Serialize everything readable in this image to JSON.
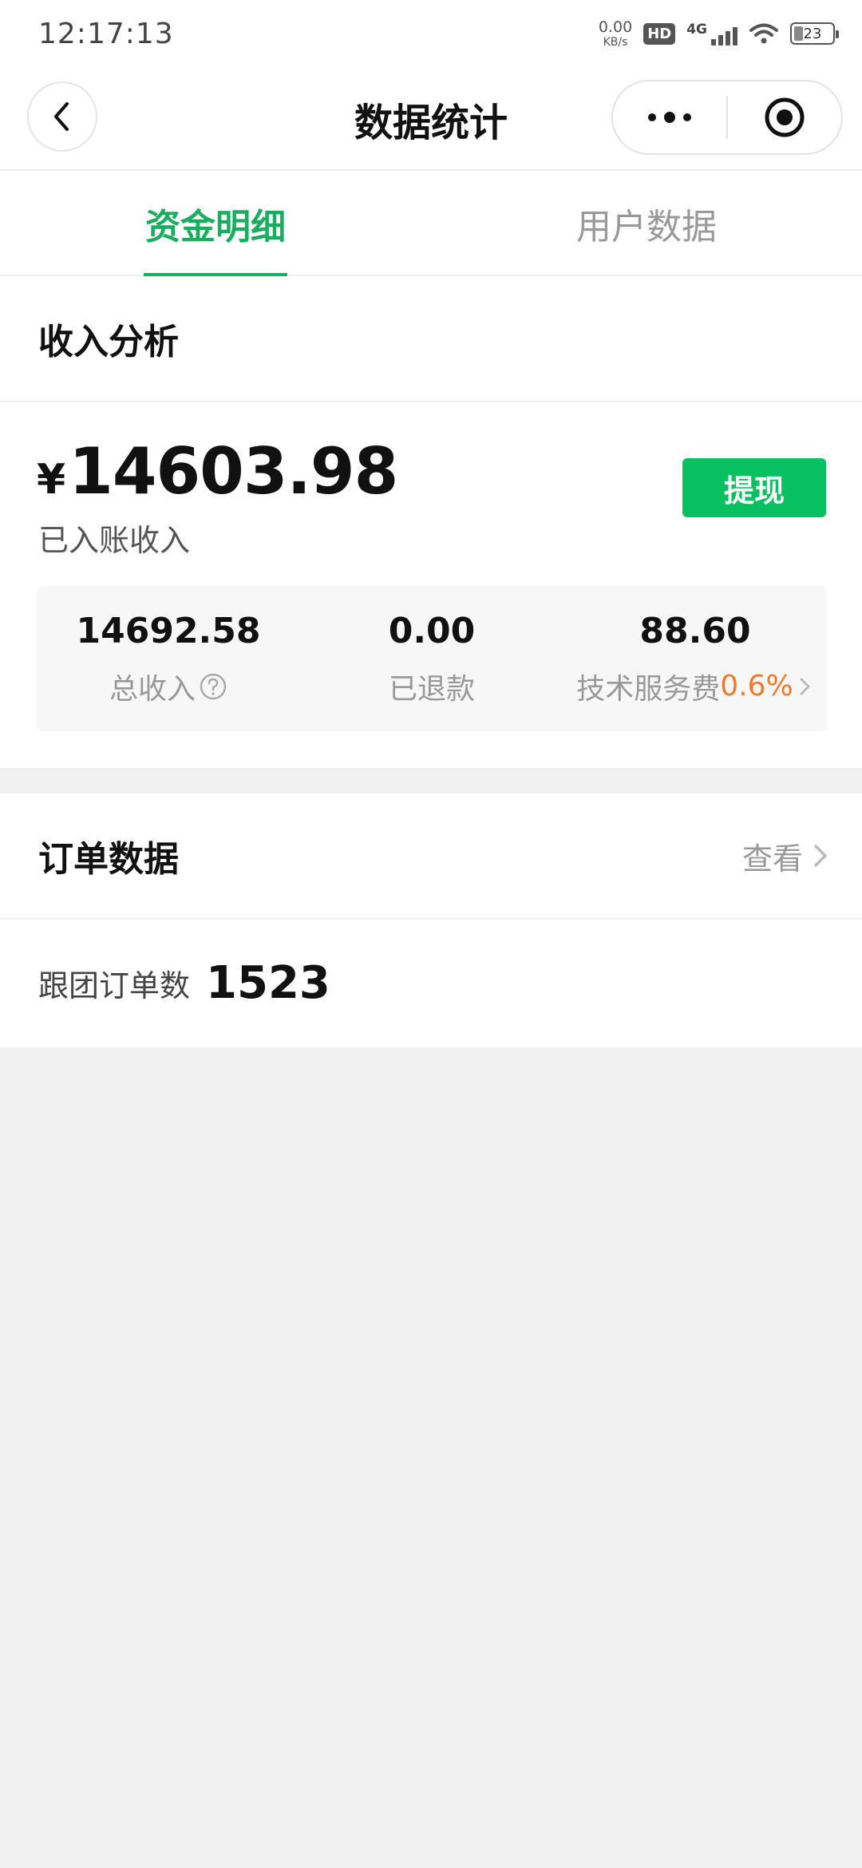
{
  "status_bar": {
    "time": "12:17:13",
    "net_speed_value": "0.00",
    "net_speed_unit": "KB/s",
    "hd_label": "HD",
    "signal_label": "4G",
    "battery_level": "23"
  },
  "nav": {
    "title": "数据统计",
    "back_icon": "chevron-left-icon",
    "more_icon": "more-dots-icon",
    "close_icon": "target-circle-icon"
  },
  "tabs": [
    {
      "label": "资金明细",
      "active": true
    },
    {
      "label": "用户数据",
      "active": false
    }
  ],
  "income": {
    "section_title": "收入分析",
    "currency": "¥",
    "amount": "14603.98",
    "amount_caption": "已入账收入",
    "withdraw_label": "提现",
    "stats": {
      "total_income_value": "14692.58",
      "total_income_label": "总收入",
      "refunded_value": "0.00",
      "refunded_label": "已退款",
      "fee_value": "88.60",
      "fee_label": "技术服务费",
      "fee_rate": "0.6%"
    }
  },
  "orders": {
    "section_title": "订单数据",
    "view_label": "查看",
    "count_label": "跟团订单数",
    "count_value": "1523"
  },
  "colors": {
    "accent": "#07c160",
    "tab_active": "#1aad5f",
    "fee_rate": "#f07a2a",
    "background": "#f0f0f0"
  }
}
